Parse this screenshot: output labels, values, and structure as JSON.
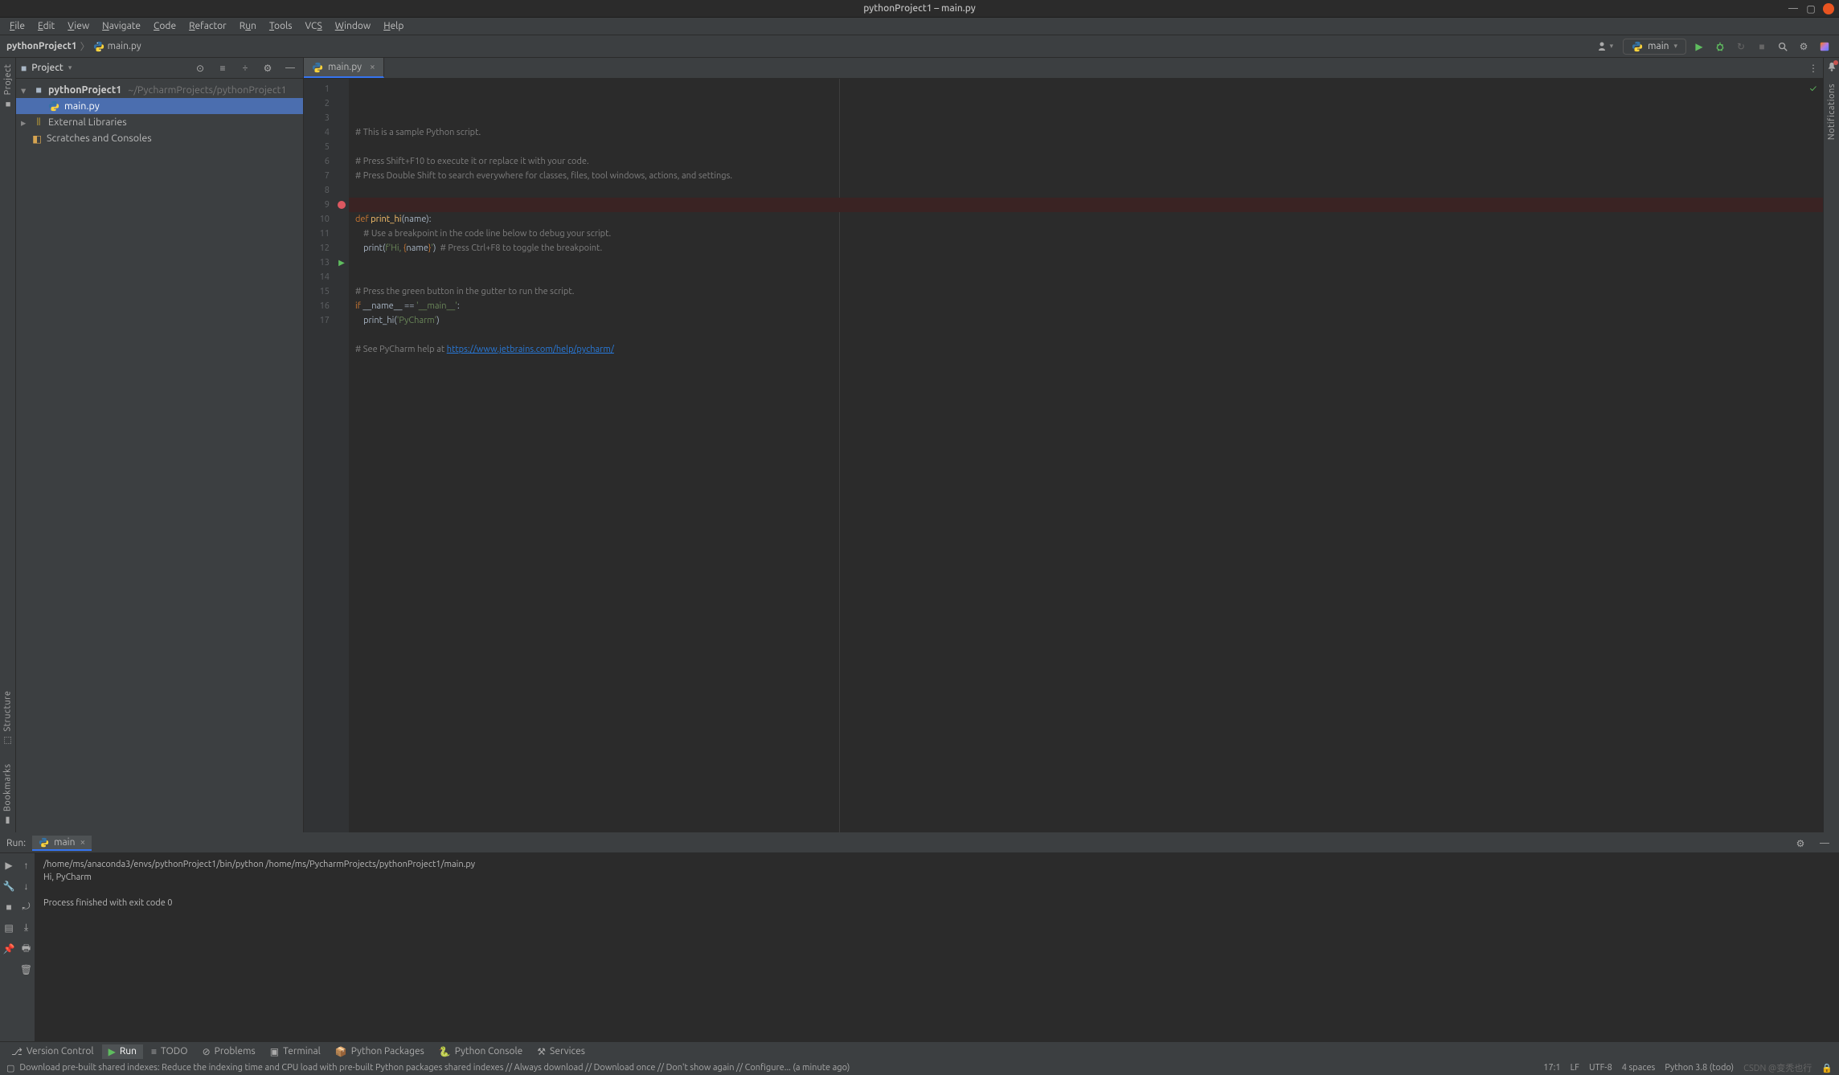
{
  "titlebar": {
    "title": "pythonProject1 – main.py"
  },
  "menus": [
    "File",
    "Edit",
    "View",
    "Navigate",
    "Code",
    "Refactor",
    "Run",
    "Tools",
    "VCS",
    "Window",
    "Help"
  ],
  "breadcrumb": {
    "project": "pythonProject1",
    "file": "main.py"
  },
  "branch": {
    "label": "main"
  },
  "project_panel": {
    "title": "Project",
    "root": {
      "name": "pythonProject1",
      "path": "~/PycharmProjects/pythonProject1"
    },
    "file": "main.py",
    "ext_libs": "External Libraries",
    "scratches": "Scratches and Consoles"
  },
  "editor_tab": {
    "file": "main.py"
  },
  "code_lines": [
    {
      "n": 1,
      "segments": [
        {
          "t": "# This is a sample Python script.",
          "c": "cm"
        }
      ]
    },
    {
      "n": 2,
      "segments": []
    },
    {
      "n": 3,
      "segments": [
        {
          "t": "# Press Shift+F10 to execute it or replace it with your code.",
          "c": "cm"
        }
      ]
    },
    {
      "n": 4,
      "segments": [
        {
          "t": "# Press Double Shift to search everywhere for classes, files, tool windows, actions, and settings.",
          "c": "cm"
        }
      ]
    },
    {
      "n": 5,
      "segments": []
    },
    {
      "n": 6,
      "segments": []
    },
    {
      "n": 7,
      "segments": [
        {
          "t": "def ",
          "c": "kw"
        },
        {
          "t": "print_hi",
          "c": "fn"
        },
        {
          "t": "(name):",
          "c": ""
        }
      ]
    },
    {
      "n": 8,
      "segments": [
        {
          "t": "    ",
          "c": ""
        },
        {
          "t": "# Use a breakpoint in the code line below to debug your script.",
          "c": "cm"
        }
      ]
    },
    {
      "n": 9,
      "bp": true,
      "segments": [
        {
          "t": "    print(",
          "c": ""
        },
        {
          "t": "f'Hi, ",
          "c": "st"
        },
        {
          "t": "{",
          "c": "br"
        },
        {
          "t": "name",
          "c": ""
        },
        {
          "t": "}",
          "c": "br"
        },
        {
          "t": "'",
          "c": "st"
        },
        {
          "t": ")",
          "c": ""
        },
        {
          "t": "  ",
          "c": ""
        },
        {
          "t": "# Press Ctrl+F8 to toggle the breakpoint.",
          "c": "cm"
        }
      ]
    },
    {
      "n": 10,
      "segments": []
    },
    {
      "n": 11,
      "segments": []
    },
    {
      "n": 12,
      "segments": [
        {
          "t": "# Press the green button in the gutter to run the script.",
          "c": "cm"
        }
      ]
    },
    {
      "n": 13,
      "run": true,
      "segments": [
        {
          "t": "if ",
          "c": "kw"
        },
        {
          "t": "__name__ == ",
          "c": ""
        },
        {
          "t": "'__main__'",
          "c": "st"
        },
        {
          "t": ":",
          "c": ""
        }
      ]
    },
    {
      "n": 14,
      "segments": [
        {
          "t": "    print_hi(",
          "c": ""
        },
        {
          "t": "'PyCharm'",
          "c": "st"
        },
        {
          "t": ")",
          "c": ""
        }
      ]
    },
    {
      "n": 15,
      "segments": []
    },
    {
      "n": 16,
      "segments": [
        {
          "t": "# See PyCharm help at ",
          "c": "cm"
        },
        {
          "t": "https://www.jetbrains.com/help/pycharm/",
          "c": "lk"
        }
      ]
    },
    {
      "n": 17,
      "segments": []
    }
  ],
  "run_panel": {
    "title": "Run:",
    "config": "main",
    "cmd": "/home/ms/anaconda3/envs/pythonProject1/bin/python /home/ms/PycharmProjects/pythonProject1/main.py",
    "out": "Hi, PyCharm",
    "exit": "Process finished with exit code 0"
  },
  "bottom_tabs": {
    "vcs": "Version Control",
    "run": "Run",
    "todo": "TODO",
    "problems": "Problems",
    "terminal": "Terminal",
    "packages": "Python Packages",
    "console": "Python Console",
    "services": "Services"
  },
  "left_tabs": {
    "project": "Project",
    "structure": "Structure",
    "bookmarks": "Bookmarks"
  },
  "right_tabs": {
    "notifications": "Notifications"
  },
  "status": {
    "msg": "Download pre-built shared indexes: Reduce the indexing time and CPU load with pre-built Python packages shared indexes // Always download // Download once // Don't show again // Configure... (a minute ago)",
    "pos": "17:1",
    "le": "LF",
    "enc": "UTF-8",
    "indent": "4 spaces",
    "interp": "Python 3.8 (todo)",
    "watermark": "CSDN @变秃也行"
  }
}
